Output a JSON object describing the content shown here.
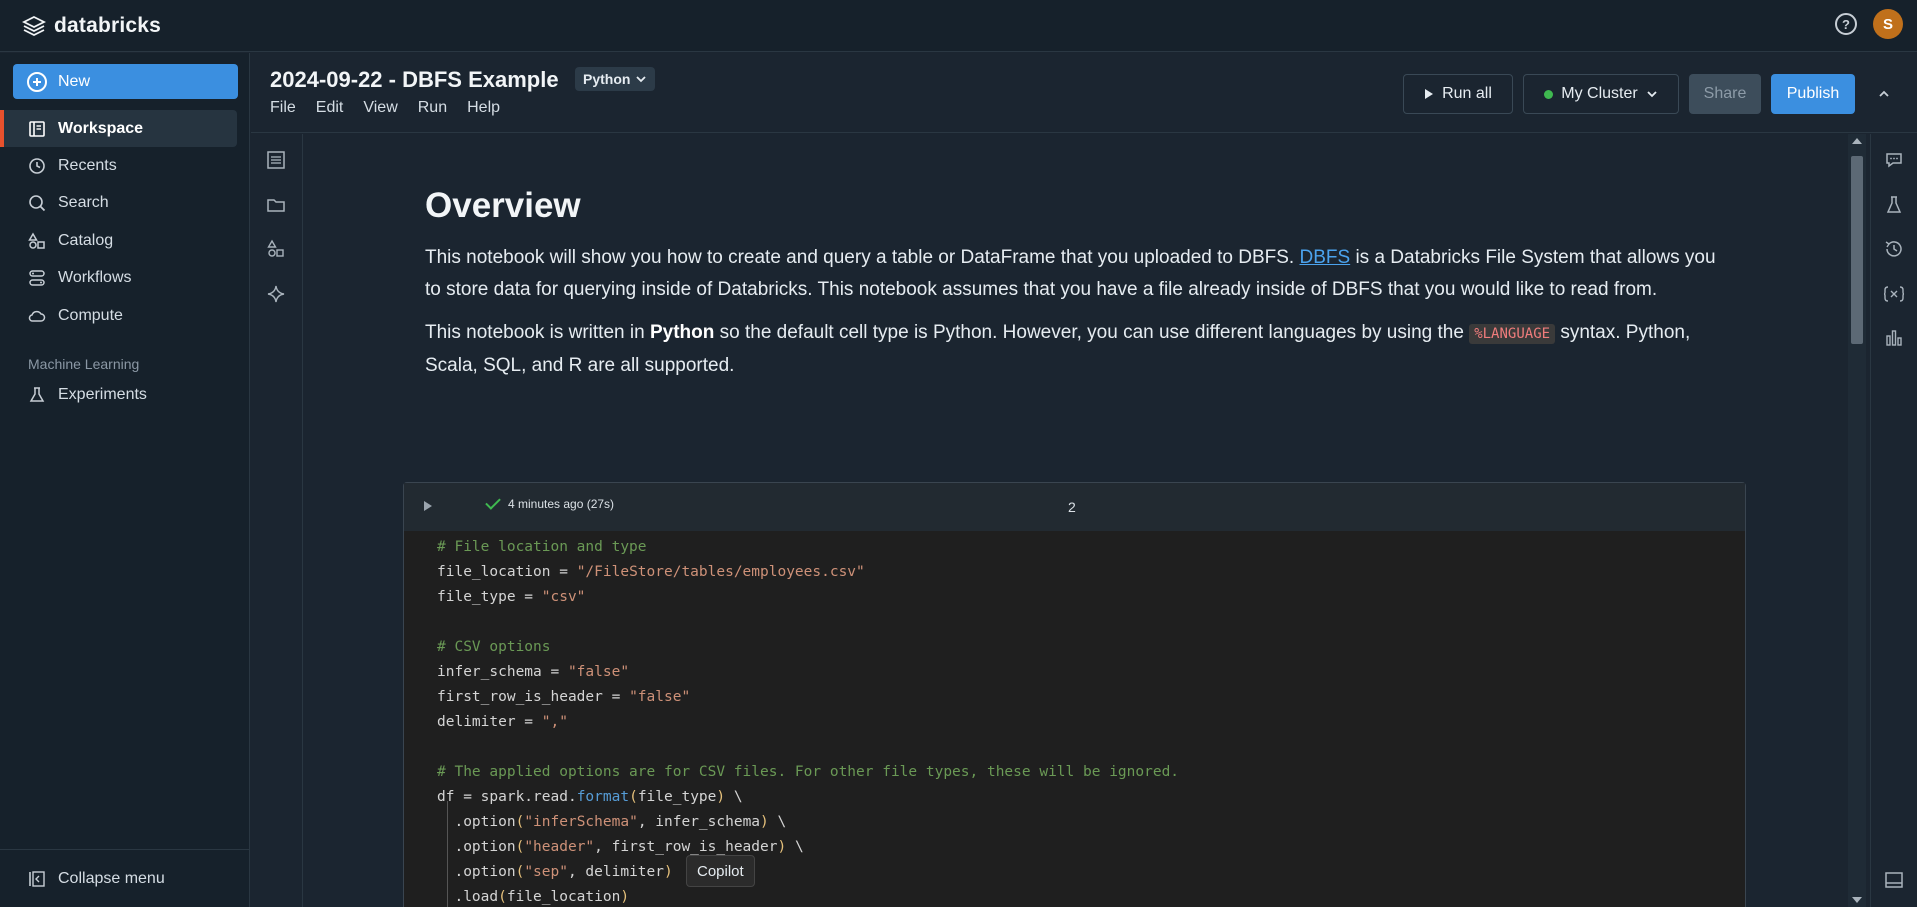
{
  "app": {
    "brand": "databricks"
  },
  "user": {
    "initial": "S"
  },
  "sidebar": {
    "new_label": "New",
    "items": [
      {
        "label": "Workspace",
        "icon": "workspace-icon",
        "active": true
      },
      {
        "label": "Recents",
        "icon": "clock-icon"
      },
      {
        "label": "Search",
        "icon": "search-icon"
      },
      {
        "label": "Catalog",
        "icon": "catalog-icon"
      },
      {
        "label": "Workflows",
        "icon": "workflows-icon"
      },
      {
        "label": "Compute",
        "icon": "cloud-icon"
      }
    ],
    "ml_section_label": "Machine Learning",
    "ml_items": [
      {
        "label": "Experiments",
        "icon": "flask-icon"
      }
    ],
    "collapse_label": "Collapse menu"
  },
  "notebook": {
    "title": "2024-09-22 - DBFS Example",
    "language": "Python",
    "menu": [
      "File",
      "Edit",
      "View",
      "Run",
      "Help"
    ],
    "run_all_label": "Run all",
    "cluster_label": "My Cluster",
    "share_label": "Share",
    "publish_label": "Publish"
  },
  "markdown": {
    "heading": "Overview",
    "p1_before": "This notebook will show you how to create and query a table or DataFrame that you uploaded to DBFS. ",
    "p1_link": "DBFS",
    "p1_after": " is a Databricks File System that allows you to store data for querying inside of Databricks. This notebook assumes that you have a file already inside of DBFS that you would like to read from.",
    "p2_before": "This notebook is written in ",
    "p2_bold": "Python",
    "p2_mid": " so the default cell type is Python. However, you can use different languages by using the ",
    "p2_code": "%LANGUAGE",
    "p2_after": " syntax. Python, Scala, SQL, and R are all supported."
  },
  "cell": {
    "status": "4 minutes ago (27s)",
    "number": "2",
    "code": {
      "l1": "# File location and type",
      "l2a": "file_location = ",
      "l2b": "\"/FileStore/tables/employees.csv\"",
      "l3a": "file_type = ",
      "l3b": "\"csv\"",
      "l5": "# CSV options",
      "l6a": "infer_schema = ",
      "l6b": "\"false\"",
      "l7a": "first_row_is_header = ",
      "l7b": "\"false\"",
      "l8a": "delimiter = ",
      "l8b": "\",\"",
      "l10": "# The applied options are for CSV files. For other file types, these will be ignored.",
      "l11a": "df = spark.read.",
      "l11b": "format",
      "l11c": "(",
      "l11d": "file_type",
      "l11e": ")",
      "l11f": " \\",
      "l12a": "  .option",
      "l12b": "(",
      "l12c": "\"inferSchema\"",
      "l12d": ", infer_schema",
      "l12e": ")",
      "l12f": " \\",
      "l13a": "  .option",
      "l13b": "(",
      "l13c": "\"header\"",
      "l13d": ", first_row_is_header",
      "l13e": ")",
      "l13f": " \\",
      "l14a": "  .option",
      "l14b": "(",
      "l14c": "\"sep\"",
      "l14d": ", delimiter",
      "l14e": ")",
      "l15a": "  .load",
      "l15b": "(",
      "l15c": "file_location",
      "l15d": ")"
    }
  },
  "tooltip": "Copilot"
}
